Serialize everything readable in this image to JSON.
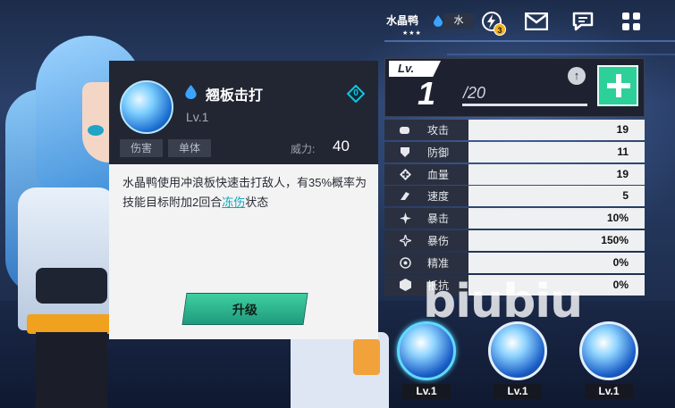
{
  "header": {
    "character_name": "水晶鸭",
    "stars": "★★★",
    "element_label": "水",
    "notification_count": "3",
    "icons": [
      "energy-icon",
      "mail-icon",
      "chat-icon",
      "menu-grid-icon"
    ]
  },
  "skill_card": {
    "name": "翘板击打",
    "level": "Lv.1",
    "cost": "0",
    "tags": [
      "伤害",
      "单体"
    ],
    "power_label": "威力:",
    "power_value": "40",
    "description_pre": "水晶鸭使用冲浪板快速击打敌人，有35%概率为技能目标附加2回合",
    "description_keyword": "冻伤",
    "description_post": "状态",
    "upgrade_label": "升级"
  },
  "level_panel": {
    "tag": "Lv.",
    "current": "1",
    "max": "/20",
    "progress": 0
  },
  "stats": [
    {
      "label": "攻击",
      "value": "19",
      "icon": "attack-fist-icon"
    },
    {
      "label": "防御",
      "value": "11",
      "icon": "shield-icon"
    },
    {
      "label": "血量",
      "value": "19",
      "icon": "health-cross-icon"
    },
    {
      "label": "速度",
      "value": "5",
      "icon": "speed-boot-icon"
    },
    {
      "label": "暴击",
      "value": "10%",
      "icon": "crit-star-icon"
    },
    {
      "label": "暴伤",
      "value": "150%",
      "icon": "crit-damage-icon"
    },
    {
      "label": "精准",
      "value": "0%",
      "icon": "accuracy-target-icon"
    },
    {
      "label": "抵抗",
      "value": "0%",
      "icon": "resist-hex-icon"
    }
  ],
  "skill_slots": [
    {
      "level": "Lv.1"
    },
    {
      "level": "Lv.1"
    },
    {
      "level": "Lv.1"
    }
  ],
  "watermark": "biubiu",
  "colors": {
    "accent_green": "#2ed09a",
    "keyword_teal": "#12a9b9",
    "panel_dark": "#222633"
  }
}
